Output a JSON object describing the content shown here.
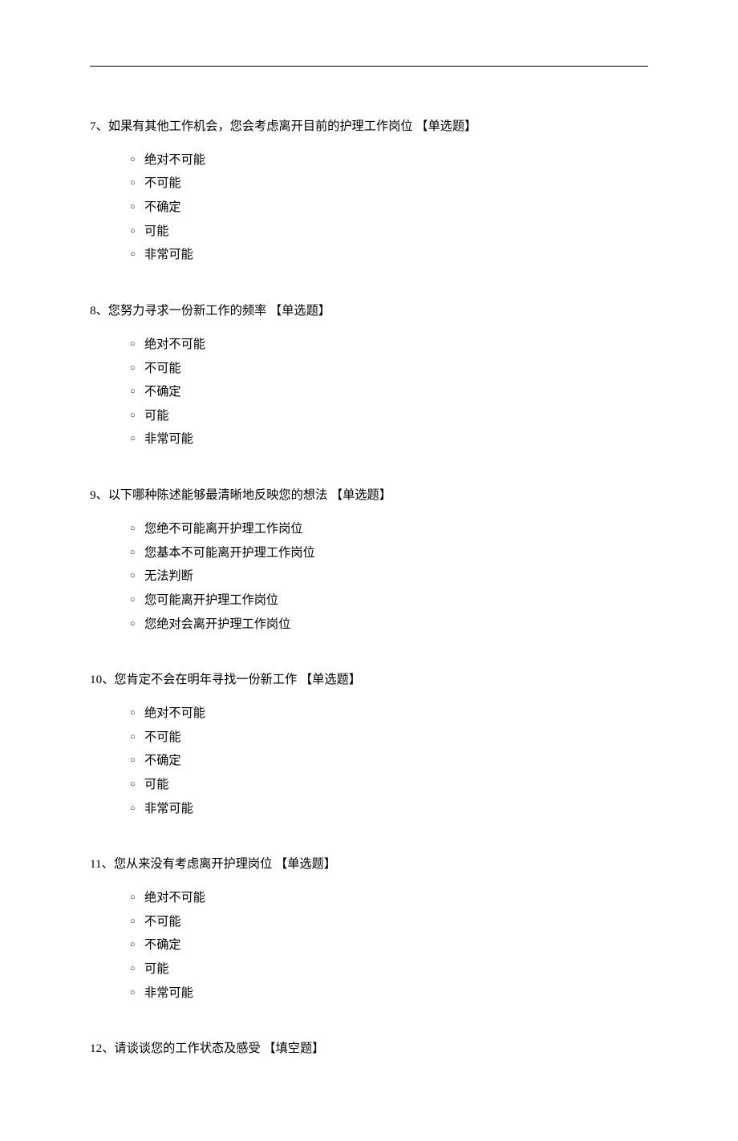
{
  "questions": [
    {
      "number": "7",
      "text": "如果有其他工作机会，您会考虑离开目前的护理工作岗位",
      "type": "【单选题】",
      "options": [
        "绝对不可能",
        "不可能",
        "不确定",
        "可能",
        "非常可能"
      ]
    },
    {
      "number": "8",
      "text": "您努力寻求一份新工作的频率",
      "type": "【单选题】",
      "options": [
        "绝对不可能",
        "不可能",
        "不确定",
        "可能",
        "非常可能"
      ]
    },
    {
      "number": "9",
      "text": "以下哪种陈述能够最清晰地反映您的想法",
      "type": "【单选题】",
      "options": [
        "您绝不可能离开护理工作岗位",
        "您基本不可能离开护理工作岗位",
        "无法判断",
        "您可能离开护理工作岗位",
        "您绝对会离开护理工作岗位"
      ]
    },
    {
      "number": "10",
      "text": "您肯定不会在明年寻找一份新工作",
      "type": "【单选题】",
      "options": [
        "绝对不可能",
        "不可能",
        "不确定",
        "可能",
        "非常可能"
      ]
    },
    {
      "number": "11",
      "text": "您从来没有考虑离开护理岗位",
      "type": "【单选题】",
      "options": [
        "绝对不可能",
        "不可能",
        "不确定",
        "可能",
        "非常可能"
      ]
    },
    {
      "number": "12",
      "text": "请谈谈您的工作状态及感受",
      "type": "【填空题】",
      "options": []
    }
  ]
}
